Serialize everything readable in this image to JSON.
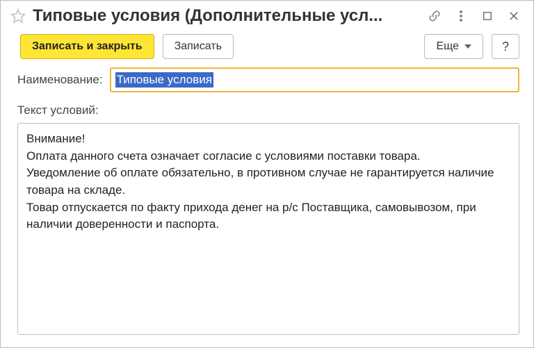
{
  "titlebar": {
    "title": "Типовые условия (Дополнительные усл..."
  },
  "toolbar": {
    "save_close_label": "Записать и закрыть",
    "save_label": "Записать",
    "more_label": "Еще",
    "help_label": "?"
  },
  "form": {
    "name_label": "Наименование:",
    "name_value": "Типовые условия",
    "text_label": "Текст условий:",
    "text_value": "Внимание!\nОплата данного счета означает согласие с условиями поставки товара.\nУведомление об оплате обязательно, в противном случае не гарантируется наличие товара на складе.\nТовар отпускается по факту прихода денег на р/с Поставщика, самовывозом, при наличии доверенности и паспорта."
  }
}
